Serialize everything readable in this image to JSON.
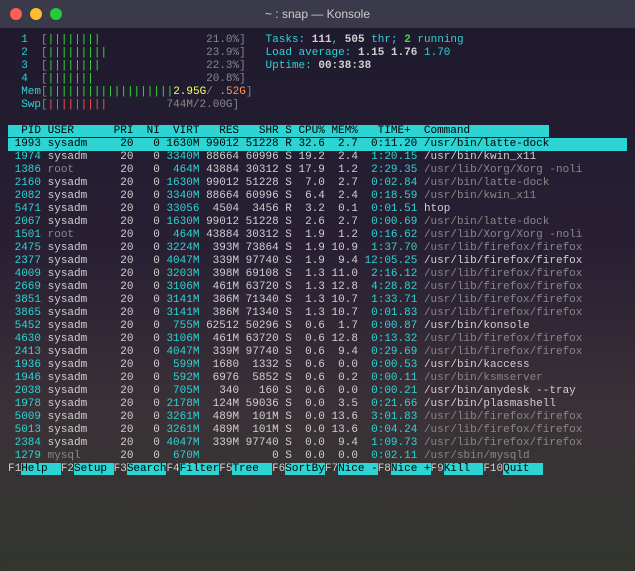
{
  "window": {
    "title": "~ : snap — Konsole"
  },
  "cpu_meters": [
    {
      "id": "1",
      "bar": "[||||||||                21.0%]"
    },
    {
      "id": "2",
      "bar": "[|||||||||               23.9%]"
    },
    {
      "id": "3",
      "bar": "[||||||||                22.3%]"
    },
    {
      "id": "4",
      "bar": "[|||||||                 20.8%]"
    }
  ],
  "mem": "[|||||||||||||||||||2.95G/ .52G]",
  "swp": "[|||||||||         744M/2.00G]",
  "tasks": {
    "label": "Tasks:",
    "procs": "111",
    "sep": ", ",
    "thr": "505",
    "thr_lbl": " thr; ",
    "running": "2",
    "run_lbl": " running"
  },
  "load": {
    "label": "Load average:",
    "l1": "1.15",
    "l2": "1.76",
    "l3": "1.70"
  },
  "uptime": {
    "label": "Uptime:",
    "value": "00:38:38"
  },
  "header": "  PID USER      PRI  NI  VIRT   RES   SHR S CPU% MEM%   TIME+  Command            ",
  "processes": [
    {
      "pid": "1993",
      "user": "sysadm",
      "pri": "20",
      "ni": "0",
      "virt": "1630M",
      "res": "99012",
      "shr": "51228",
      "s": "R",
      "cpu": "32.6",
      "mem": "2.7",
      "time": "0:11.20",
      "cmd": "/usr/bin/latte-dock",
      "sel": true
    },
    {
      "pid": "1974",
      "user": "sysadm",
      "pri": "20",
      "ni": "0",
      "virt": "3340M",
      "res": "88664",
      "shr": "60996",
      "s": "S",
      "cpu": "19.2",
      "mem": "2.4",
      "time": "1:20.15",
      "cmd": "/usr/bin/kwin_x11"
    },
    {
      "pid": "1386",
      "user": "root",
      "pri": "20",
      "ni": "0",
      "virt": "464M",
      "res": "43884",
      "shr": "30312",
      "s": "S",
      "cpu": "17.9",
      "mem": "1.2",
      "time": "2:29.35",
      "cmd": "/usr/lib/Xorg/Xorg -noli",
      "dim": true
    },
    {
      "pid": "2160",
      "user": "sysadm",
      "pri": "20",
      "ni": "0",
      "virt": "1630M",
      "res": "99012",
      "shr": "51228",
      "s": "S",
      "cpu": "7.0",
      "mem": "2.7",
      "time": "0:02.84",
      "cmd": "/usr/bin/latte-dock",
      "dim": true
    },
    {
      "pid": "2082",
      "user": "sysadm",
      "pri": "20",
      "ni": "0",
      "virt": "3340M",
      "res": "88664",
      "shr": "60996",
      "s": "S",
      "cpu": "6.4",
      "mem": "2.4",
      "time": "0:18.59",
      "cmd": "/usr/bin/kwin_x11",
      "dim": true
    },
    {
      "pid": "5471",
      "user": "sysadm",
      "pri": "20",
      "ni": "0",
      "virt": "33056",
      "res": "4504",
      "shr": "3456",
      "s": "R",
      "cpu": "3.2",
      "mem": "0.1",
      "time": "0:01.51",
      "cmd": "htop"
    },
    {
      "pid": "2067",
      "user": "sysadm",
      "pri": "20",
      "ni": "0",
      "virt": "1630M",
      "res": "99012",
      "shr": "51228",
      "s": "S",
      "cpu": "2.6",
      "mem": "2.7",
      "time": "0:00.69",
      "cmd": "/usr/bin/latte-dock",
      "dim": true
    },
    {
      "pid": "1501",
      "user": "root",
      "pri": "20",
      "ni": "0",
      "virt": "464M",
      "res": "43884",
      "shr": "30312",
      "s": "S",
      "cpu": "1.9",
      "mem": "1.2",
      "time": "0:16.62",
      "cmd": "/usr/lib/Xorg/Xorg -noli",
      "dim": true
    },
    {
      "pid": "2475",
      "user": "sysadm",
      "pri": "20",
      "ni": "0",
      "virt": "3224M",
      "res": "393M",
      "shr": "73864",
      "s": "S",
      "cpu": "1.9",
      "mem": "10.9",
      "time": "1:37.70",
      "cmd": "/usr/lib/firefox/firefox",
      "dim": true
    },
    {
      "pid": "2377",
      "user": "sysadm",
      "pri": "20",
      "ni": "0",
      "virt": "4047M",
      "res": "339M",
      "shr": "97740",
      "s": "S",
      "cpu": "1.9",
      "mem": "9.4",
      "time": "12:05.25",
      "cmd": "/usr/lib/firefox/firefox"
    },
    {
      "pid": "4009",
      "user": "sysadm",
      "pri": "20",
      "ni": "0",
      "virt": "3203M",
      "res": "398M",
      "shr": "69108",
      "s": "S",
      "cpu": "1.3",
      "mem": "11.0",
      "time": "2:16.12",
      "cmd": "/usr/lib/firefox/firefox",
      "dim": true
    },
    {
      "pid": "2669",
      "user": "sysadm",
      "pri": "20",
      "ni": "0",
      "virt": "3106M",
      "res": "461M",
      "shr": "63720",
      "s": "S",
      "cpu": "1.3",
      "mem": "12.8",
      "time": "4:28.82",
      "cmd": "/usr/lib/firefox/firefox",
      "dim": true
    },
    {
      "pid": "3851",
      "user": "sysadm",
      "pri": "20",
      "ni": "0",
      "virt": "3141M",
      "res": "386M",
      "shr": "71340",
      "s": "S",
      "cpu": "1.3",
      "mem": "10.7",
      "time": "1:33.71",
      "cmd": "/usr/lib/firefox/firefox",
      "dim": true
    },
    {
      "pid": "3865",
      "user": "sysadm",
      "pri": "20",
      "ni": "0",
      "virt": "3141M",
      "res": "386M",
      "shr": "71340",
      "s": "S",
      "cpu": "1.3",
      "mem": "10.7",
      "time": "0:01.83",
      "cmd": "/usr/lib/firefox/firefox",
      "dim": true
    },
    {
      "pid": "5452",
      "user": "sysadm",
      "pri": "20",
      "ni": "0",
      "virt": "755M",
      "res": "62512",
      "shr": "50296",
      "s": "S",
      "cpu": "0.6",
      "mem": "1.7",
      "time": "0:00.87",
      "cmd": "/usr/bin/konsole"
    },
    {
      "pid": "4630",
      "user": "sysadm",
      "pri": "20",
      "ni": "0",
      "virt": "3106M",
      "res": "461M",
      "shr": "63720",
      "s": "S",
      "cpu": "0.6",
      "mem": "12.8",
      "time": "0:13.32",
      "cmd": "/usr/lib/firefox/firefox",
      "dim": true
    },
    {
      "pid": "2413",
      "user": "sysadm",
      "pri": "20",
      "ni": "0",
      "virt": "4047M",
      "res": "339M",
      "shr": "97740",
      "s": "S",
      "cpu": "0.6",
      "mem": "9.4",
      "time": "0:29.69",
      "cmd": "/usr/lib/firefox/firefox",
      "dim": true
    },
    {
      "pid": "1936",
      "user": "sysadm",
      "pri": "20",
      "ni": "0",
      "virt": "599M",
      "res": "1680",
      "shr": "1332",
      "s": "S",
      "cpu": "0.6",
      "mem": "0.0",
      "time": "0:00.53",
      "cmd": "/usr/bin/kaccess"
    },
    {
      "pid": "1946",
      "user": "sysadm",
      "pri": "20",
      "ni": "0",
      "virt": "592M",
      "res": "6976",
      "shr": "5852",
      "s": "S",
      "cpu": "0.6",
      "mem": "0.2",
      "time": "0:00.11",
      "cmd": "/usr/bin/ksmserver",
      "dim": true
    },
    {
      "pid": "2038",
      "user": "sysadm",
      "pri": "20",
      "ni": "0",
      "virt": "705M",
      "res": "340",
      "shr": "160",
      "s": "S",
      "cpu": "0.6",
      "mem": "0.0",
      "time": "0:00.21",
      "cmd": "/usr/bin/anydesk --tray"
    },
    {
      "pid": "1978",
      "user": "sysadm",
      "pri": "20",
      "ni": "0",
      "virt": "2178M",
      "res": "124M",
      "shr": "59036",
      "s": "S",
      "cpu": "0.0",
      "mem": "3.5",
      "time": "0:21.66",
      "cmd": "/usr/bin/plasmashell"
    },
    {
      "pid": "5009",
      "user": "sysadm",
      "pri": "20",
      "ni": "0",
      "virt": "3261M",
      "res": "489M",
      "shr": "101M",
      "s": "S",
      "cpu": "0.0",
      "mem": "13.6",
      "time": "3:01.83",
      "cmd": "/usr/lib/firefox/firefox",
      "dim": true
    },
    {
      "pid": "5013",
      "user": "sysadm",
      "pri": "20",
      "ni": "0",
      "virt": "3261M",
      "res": "489M",
      "shr": "101M",
      "s": "S",
      "cpu": "0.0",
      "mem": "13.6",
      "time": "0:04.24",
      "cmd": "/usr/lib/firefox/firefox",
      "dim": true
    },
    {
      "pid": "2384",
      "user": "sysadm",
      "pri": "20",
      "ni": "0",
      "virt": "4047M",
      "res": "339M",
      "shr": "97740",
      "s": "S",
      "cpu": "0.0",
      "mem": "9.4",
      "time": "1:09.73",
      "cmd": "/usr/lib/firefox/firefox",
      "dim": true
    },
    {
      "pid": "1279",
      "user": "mysql",
      "pri": "20",
      "ni": "0",
      "virt": "670M",
      "res": "",
      "shr": "0",
      "s": "S",
      "cpu": "0.0",
      "mem": "0.0",
      "time": "0:02.11",
      "cmd": "/usr/sbin/mysqld",
      "dim": true
    }
  ],
  "fkeys": [
    {
      "k": "F1",
      "l": "Help  "
    },
    {
      "k": "F2",
      "l": "Setup "
    },
    {
      "k": "F3",
      "l": "Search"
    },
    {
      "k": "F4",
      "l": "Filter"
    },
    {
      "k": "F5",
      "l": "Tree  "
    },
    {
      "k": "F6",
      "l": "SortBy"
    },
    {
      "k": "F7",
      "l": "Nice -"
    },
    {
      "k": "F8",
      "l": "Nice +"
    },
    {
      "k": "F9",
      "l": "Kill  "
    },
    {
      "k": "F10",
      "l": "Quit  "
    }
  ]
}
